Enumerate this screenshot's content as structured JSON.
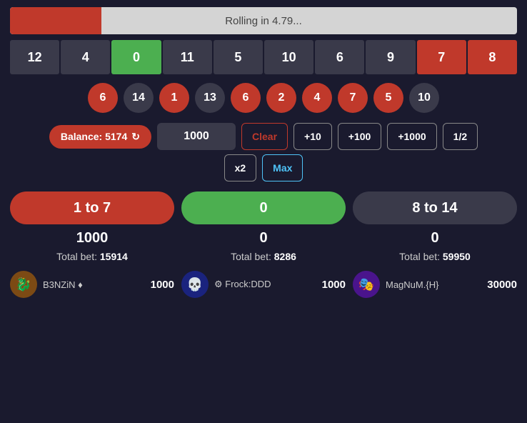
{
  "progress": {
    "fill_percent": "18%",
    "text": "Rolling in 4.79..."
  },
  "tiles": [
    {
      "value": "12",
      "type": "dark"
    },
    {
      "value": "4",
      "type": "dark"
    },
    {
      "value": "0",
      "type": "green"
    },
    {
      "value": "11",
      "type": "dark"
    },
    {
      "value": "5",
      "type": "dark"
    },
    {
      "value": "10",
      "type": "dark"
    },
    {
      "value": "6",
      "type": "dark"
    },
    {
      "value": "9",
      "type": "dark"
    },
    {
      "value": "7",
      "type": "red"
    },
    {
      "value": "8",
      "type": "red"
    }
  ],
  "dice_history": [
    {
      "value": "6",
      "type": "red"
    },
    {
      "value": "14",
      "type": "dark"
    },
    {
      "value": "1",
      "type": "red"
    },
    {
      "value": "13",
      "type": "dark"
    },
    {
      "value": "6",
      "type": "red"
    },
    {
      "value": "2",
      "type": "red"
    },
    {
      "value": "4",
      "type": "red"
    },
    {
      "value": "7",
      "type": "red"
    },
    {
      "value": "5",
      "type": "red"
    },
    {
      "value": "10",
      "type": "dark"
    }
  ],
  "controls": {
    "balance_label": "Balance: 5174",
    "bet_value": "1000",
    "clear_label": "Clear",
    "plus10_label": "+10",
    "plus100_label": "+100",
    "plus1000_label": "+1000",
    "half_label": "1/2",
    "x2_label": "x2",
    "max_label": "Max"
  },
  "bet_sections": [
    {
      "label": "1 to 7",
      "type": "red",
      "amount": "1000",
      "total_bet_prefix": "Total bet: ",
      "total_bet_value": "15914"
    },
    {
      "label": "0",
      "type": "green",
      "amount": "0",
      "total_bet_prefix": "Total bet: ",
      "total_bet_value": "8286"
    },
    {
      "label": "8 to 14",
      "type": "dark",
      "amount": "0",
      "total_bet_prefix": "Total bet: ",
      "total_bet_value": "59950"
    }
  ],
  "players": [
    {
      "name": "B3NZiN ♦",
      "bet": "1000",
      "avatar_emoji": "🐉",
      "avatar_bg": "#7c4a14",
      "gear": false
    },
    {
      "name": "⚙ Frock:DDD",
      "bet": "1000",
      "avatar_emoji": "💀",
      "avatar_bg": "#1a237e",
      "gear": false
    },
    {
      "name": "MagNuM.{H}",
      "bet": "30000",
      "avatar_emoji": "🎭",
      "avatar_bg": "#4a148c",
      "gear": false
    }
  ]
}
